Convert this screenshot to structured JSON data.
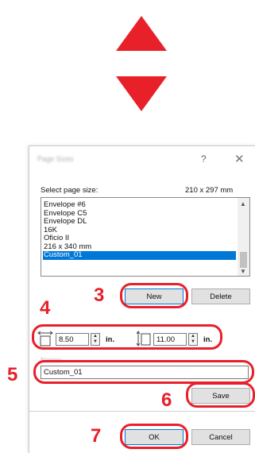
{
  "dialog": {
    "title": "Page Sizes",
    "help_glyph": "?",
    "close_glyph": "✕",
    "select_label": "Select page size:",
    "size_readout": "210 x 297 mm",
    "page_sizes": [
      "Envelope #6",
      "Envelope C5",
      "Envelope DL",
      "16K",
      "Oficio II",
      "216 x 340 mm",
      "Custom_01"
    ],
    "selected_index": 6,
    "new_label": "New",
    "delete_label": "Delete",
    "width_value": "8.50",
    "height_value": "11.00",
    "unit": "in.",
    "name_label": "Name:",
    "name_value": "Custom_01",
    "save_label": "Save",
    "ok_label": "OK",
    "cancel_label": "Cancel"
  },
  "callouts": {
    "step3": "3",
    "step4": "4",
    "step5": "5",
    "step6": "6",
    "step7": "7"
  },
  "colors": {
    "accent_red": "#e8202a",
    "selection_blue": "#0078d7"
  },
  "icons": {
    "up_arrow": "triangle-up-icon",
    "down_arrow": "triangle-down-icon",
    "width": "width-dimension-icon",
    "height": "height-dimension-icon"
  }
}
